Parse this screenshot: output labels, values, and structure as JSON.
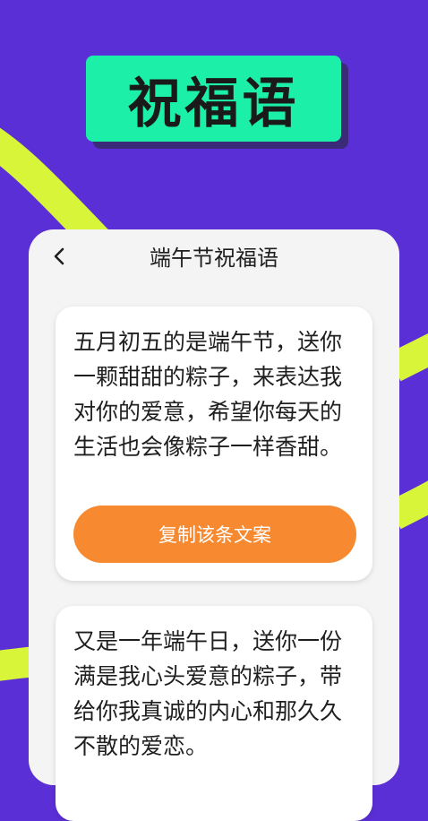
{
  "banner": {
    "title": "祝福语"
  },
  "header": {
    "title": "端午节祝福语",
    "back_icon": "chevron-left-icon"
  },
  "cards": [
    {
      "text": "五月初五的是端午节，送你一颗甜甜的粽子，来表达我对你的爱意，希望你每天的生活也会像粽子一样香甜。",
      "copy_label": "复制该条文案"
    },
    {
      "text": "又是一年端午日，送你一份满是我心头爱意的粽子，带给你我真诚的内心和那久久不散的爱恋。"
    }
  ],
  "colors": {
    "background": "#5b2fd6",
    "banner": "#1cf0a8",
    "accent_stripe": "#d8f53a",
    "button": "#f78a30",
    "panel": "#f4f4f4"
  }
}
